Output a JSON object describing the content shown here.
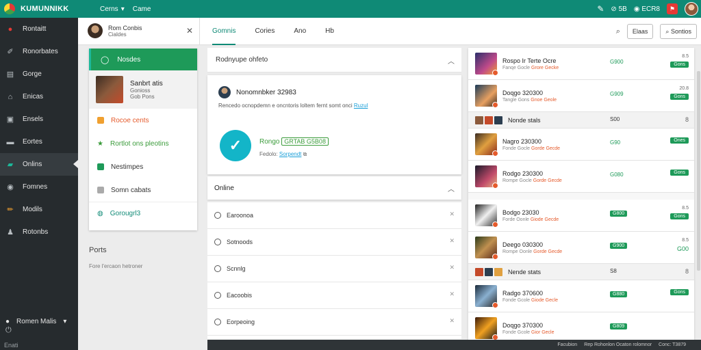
{
  "topbar": {
    "brand": "KUMUNNIKK",
    "menu1": "Cerns",
    "menu2": "Came",
    "r1": "5B",
    "r2": "ECR8"
  },
  "sidebar": {
    "items": [
      {
        "label": "Rontaitt",
        "icon": "app-logo-icon"
      },
      {
        "label": "Ronorbates",
        "icon": "edit-icon"
      },
      {
        "label": "Gorge",
        "icon": "doc-icon"
      },
      {
        "label": "Enicas",
        "icon": "home-icon"
      },
      {
        "label": "Ensels",
        "icon": "folder-icon"
      },
      {
        "label": "Eortes",
        "icon": "card-icon"
      },
      {
        "label": "Onlins",
        "icon": "chat-icon"
      },
      {
        "label": "Fomnes",
        "icon": "globe-icon"
      },
      {
        "label": "Modils",
        "icon": "pencil-icon"
      },
      {
        "label": "Rotonbs",
        "icon": "people-icon"
      }
    ],
    "bottom_label": "Romen Malis",
    "footer": "Enati"
  },
  "header": {
    "user_name": "Rom Conbis",
    "user_sub": "Cialdes",
    "tabs": [
      "Gomnis",
      "Cories",
      "Ano",
      "Hb"
    ],
    "search_btn": "Elaas",
    "settings_btn": "Sontios"
  },
  "leftcard": {
    "header": "Nosdes",
    "profile_name": "Sanbrt atis",
    "profile_sub1": "Gonioss",
    "profile_sub2": "Gob Pons",
    "items": [
      {
        "label": "Rocoe cents",
        "style": "orange"
      },
      {
        "label": "Rortlot ons pleotins",
        "style": "green"
      },
      {
        "label": "Nestimpes",
        "style": ""
      },
      {
        "label": "Somn cabats",
        "style": ""
      },
      {
        "label": "Gorougrl3",
        "style": "teal"
      }
    ]
  },
  "ports": {
    "title": "Ports",
    "sub": "Fore l'ercaon hetroner"
  },
  "middle": {
    "head": "Rodnyupe ohfeto",
    "card_name": "Nonomnbker 32983",
    "card_desc": "Rencedo ocnopdemn e oncntoris loltem fernt somt onci",
    "card_link": "Ruzul",
    "status_prefix": "Rongo",
    "status_box": "GRTAB G5B08",
    "status2_prefix": "Fedolo:",
    "status2_link": "Sorpendt",
    "online_title": "Online",
    "online_items": [
      "Earoonoa",
      "Sotnoods",
      "Scnnlg",
      "Eacoobis",
      "Eorpeoing"
    ]
  },
  "feed": [
    {
      "kind": "tall",
      "title": "Rospo Ir Terte Ocre",
      "sub": "Fanqe Gocle",
      "subo": "Grore Gecke",
      "score": "G900",
      "r1": "8.5",
      "badge": "Gons"
    },
    {
      "kind": "tall",
      "title": "Doqgo 320300",
      "sub": "Tangle Gons",
      "subo": "Gnoe Geole",
      "score": "G909",
      "r1": "20.8",
      "badge": "Gons"
    },
    {
      "kind": "short",
      "title": "Nonde stals",
      "score": "S00",
      "r1": "8"
    },
    {
      "kind": "tall",
      "title": "Nagro 230300",
      "sub": "Fonde Gocle",
      "subo": "Gorde Gecde",
      "score": "G90",
      "r1": "",
      "badge": "Ones"
    },
    {
      "kind": "tall",
      "title": "Rodgo 230300",
      "sub": "Rompe Gocle",
      "subo": "Gorde Gecde",
      "score": "G080",
      "r1": "",
      "badge": "Gons"
    },
    {
      "kind": "tall",
      "title": "Bodgo 23030",
      "sub": "Forde Oonle",
      "subo": "Giode Gecde",
      "score": "G800",
      "boxscore": true,
      "r1": "8.5",
      "badge": "Gons"
    },
    {
      "kind": "tall",
      "title": "Deego 030300",
      "sub": "Rompe Oonle",
      "subo": "Gorde Gecde",
      "score": "G900",
      "boxscore": true,
      "r1": "8.5",
      "r2": "G00"
    },
    {
      "kind": "short",
      "title": "Nende stats",
      "score": "S8",
      "r1": "8"
    },
    {
      "kind": "tall",
      "title": "Radgo 370600",
      "sub": "Fonde Gcole",
      "subo": "Giode Gecle",
      "score": "G880",
      "boxscore": true,
      "r1": "",
      "badge": "Gons"
    },
    {
      "kind": "tall",
      "title": "Doqgo 370300",
      "sub": "Fonde Gcole",
      "subo": "Gior Gecle",
      "score": "G809",
      "boxscore": true,
      "r1": "",
      "badge": ""
    }
  ],
  "footer": {
    "a": "Facubion",
    "b": "Rep Rohonlon Ocaton rolomnor",
    "c": "Conc: T3879"
  },
  "colors": {
    "brand": "#0f8a76",
    "green": "#1e9a59",
    "sidebar": "#262b2e",
    "accent_blue": "#13b5c8",
    "orange": "#e55a2b"
  }
}
